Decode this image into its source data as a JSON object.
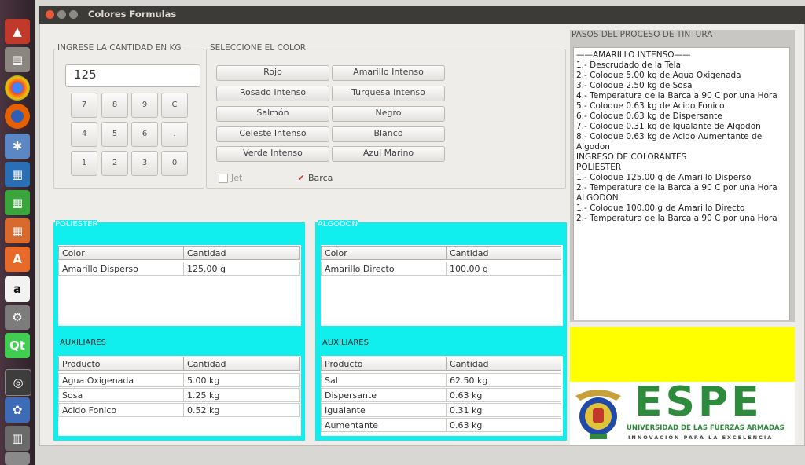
{
  "window": {
    "title": "Colores Formulas"
  },
  "input_group": {
    "title": "INGRESE LA CANTIDAD EN KG",
    "value": "125"
  },
  "keypad": {
    "keys": [
      "7",
      "8",
      "9",
      "C",
      "4",
      "5",
      "6",
      ".",
      "1",
      "2",
      "3",
      "0"
    ]
  },
  "color_group": {
    "title": "SELECCIONE EL COLOR",
    "buttons": [
      "Rojo",
      "Amarillo Intenso",
      "Rosado Intenso",
      "Turquesa Intenso",
      "Salmón",
      "Negro",
      "Celeste Intenso",
      "Blanco",
      "Verde Intenso",
      "Azul Marino"
    ],
    "jet_label": "Jet",
    "jet_checked": false,
    "barca_label": "Barca",
    "barca_checked": true
  },
  "poliester": {
    "title": "POLIESTER",
    "headers": [
      "Color",
      "Cantidad"
    ],
    "rows": [
      [
        "Amarillo Disperso",
        "125.00 g"
      ]
    ],
    "aux_title": "AUXILIARES",
    "aux_headers": [
      "Producto",
      "Cantidad"
    ],
    "aux_rows": [
      [
        "Agua Oxigenada",
        "5.00 kg"
      ],
      [
        "Sosa",
        "1.25 kg"
      ],
      [
        "Acido Fonico",
        "0.52 kg"
      ]
    ]
  },
  "algodon": {
    "title": "ALGODON",
    "headers": [
      "Color",
      "Cantidad"
    ],
    "rows": [
      [
        "Amarillo Directo",
        "100.00 g"
      ]
    ],
    "aux_title": "AUXILIARES",
    "aux_headers": [
      "Producto",
      "Cantidad"
    ],
    "aux_rows": [
      [
        "Sal",
        "62.50 kg"
      ],
      [
        "Dispersante",
        "0.63 kg"
      ],
      [
        "Igualante",
        "0.31 kg"
      ],
      [
        "Aumentante",
        "0.63 kg"
      ]
    ]
  },
  "steps": {
    "title": "PASOS DEL PROCESO DE TINTURA",
    "lines": [
      "——AMARILLO INTENSO——",
      "1.- Descrudado de la Tela",
      "2.- Coloque 5.00 kg de Agua Oxigenada",
      "3.- Coloque 2.50 kg de Sosa",
      "4.- Temperatura de la Barca a 90 C por una Hora",
      "5.- Coloque 0.63 kg de Acido Fonico",
      "6.- Coloque 0.63 kg de Dispersante",
      "7.- Coloque 0.31 kg de Igualante de Algodon",
      "8.- Coloque 0.63 kg de Acido Aumentante de",
      "Algodon",
      "INGRESO DE COLORANTES",
      "POLIESTER",
      "1.- Coloque 125.00 g de Amarillo Disperso",
      "2.- Temperatura de la Barca a 90 C por una Hora",
      "ALGODON",
      "1.- Coloque 100.00 g de Amarillo Directo",
      "2.- Temperatura de la Barca a 90 C por una Hora"
    ]
  },
  "logo": {
    "name": "ESPE",
    "subtitle": "UNIVERSIDAD DE LAS FUERZAS ARMADAS",
    "tagline": "INNOVACIÓN PARA LA EXCELENCIA",
    "color": "#2e8b3e"
  },
  "launcher": {
    "icons": [
      "ubuntu-dash-icon",
      "files-icon",
      "chrome-icon",
      "firefox-icon",
      "settings-icon",
      "writer-icon",
      "calc-icon",
      "impress-icon",
      "software-center-icon",
      "amazon-icon",
      "system-settings-icon",
      "qt-creator-icon",
      "app-icon",
      "paw-icon",
      "workspace-icon",
      "trash-icon"
    ]
  },
  "colors": {
    "accent_cyan": "#11eeee",
    "yellow_panel": "#ffff00",
    "launcher_bg": "#3b2a33"
  }
}
